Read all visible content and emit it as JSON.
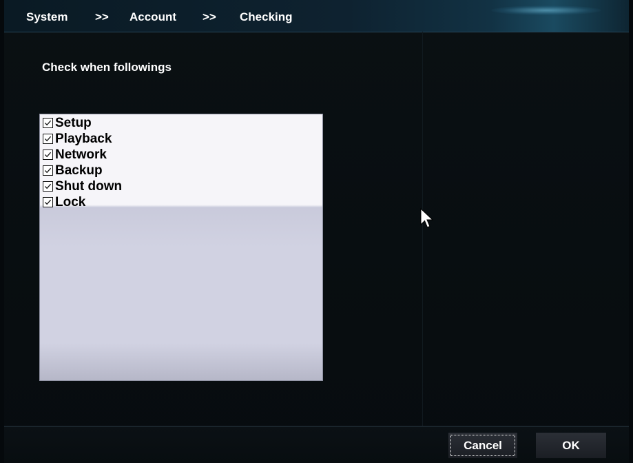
{
  "breadcrumb": {
    "items": [
      "System",
      "Account",
      "Checking"
    ],
    "separator": ">>"
  },
  "section": {
    "title": "Check when followings"
  },
  "checklist": {
    "items": [
      {
        "label": "Setup",
        "checked": true
      },
      {
        "label": "Playback",
        "checked": true
      },
      {
        "label": "Network",
        "checked": true
      },
      {
        "label": "Backup",
        "checked": true
      },
      {
        "label": "Shut down",
        "checked": true
      },
      {
        "label": "Lock",
        "checked": true
      }
    ]
  },
  "footer": {
    "cancel_label": "Cancel",
    "ok_label": "OK"
  },
  "colors": {
    "background": "#05090c",
    "header_accent": "#1a4a60",
    "list_background": "#f6f5f9",
    "list_empty": "#d1d2e2",
    "text": "#ffffff"
  },
  "icons": {
    "checkbox": "checkbox-checked-icon",
    "cursor": "mouse-pointer-icon"
  }
}
